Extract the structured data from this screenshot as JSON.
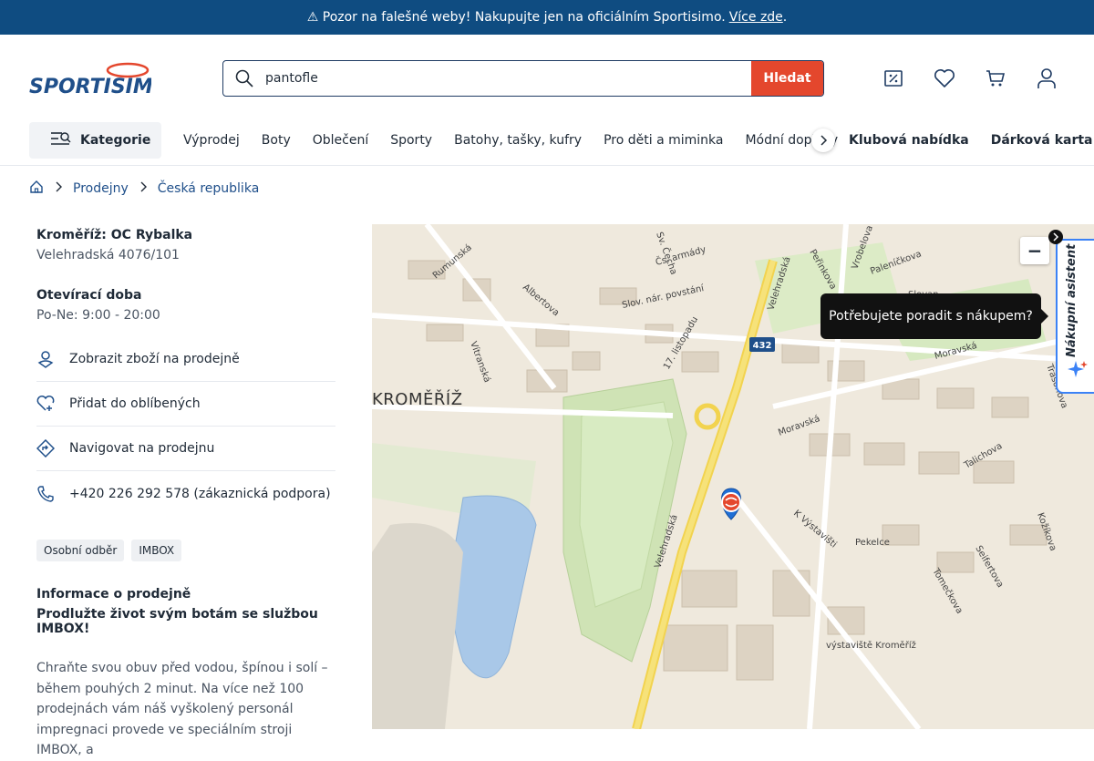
{
  "topbar": {
    "warning": "⚠ Pozor na falešné weby! Nakupujte jen na oficiálním Sportisimo.",
    "link": "Více zde",
    "trailing": "."
  },
  "brand": {
    "logo_text": "SPORTISIMO",
    "logo_color": "#1f4f8a",
    "accent": "#e4472d"
  },
  "search": {
    "value": "pantofle",
    "button": "Hledat"
  },
  "nav": {
    "categories_label": "Kategorie",
    "items": [
      "Výprodej",
      "Boty",
      "Oblečení",
      "Sporty",
      "Batohy, tašky, kufry",
      "Pro děti a miminka",
      "Módní doplňky"
    ],
    "right_items": [
      "Klubová nabídka",
      "Dárková karta"
    ]
  },
  "breadcrumb": {
    "items": [
      "Prodejny",
      "Česká republika"
    ]
  },
  "store": {
    "name": "Kroměříž: OC Rybalka",
    "address": "Velehradská 4076/101",
    "hours_title": "Otevírací doba",
    "hours": "Po-Ne: 9:00 - 20:00"
  },
  "actions": [
    {
      "label": "Zobrazit zboží na prodejně",
      "icon": "store-location-icon"
    },
    {
      "label": "Přidat do oblíbených",
      "icon": "heart-plus-icon"
    },
    {
      "label": "Navigovat na prodejnu",
      "icon": "directions-icon"
    },
    {
      "label": "+420 226 292 578 (zákaznická podpora)",
      "icon": "phone-icon"
    }
  ],
  "tags": [
    "Osobní odběr",
    "IMBOX"
  ],
  "info": {
    "title": "Informace o prodejně",
    "subtitle": "Prodlužte život svým botám se službou IMBOX!",
    "text": "Chraňte svou obuv před vodou, špínou i solí – během pouhých 2 minut. Na více než 100 prodejnách vám náš vyškolený personál impregnaci provede ve speciálním stroji IMBOX, a"
  },
  "map": {
    "city_label": "KROMĚŘÍŽ",
    "streets": [
      "Rumunská",
      "Albertova",
      "Sv. Čecha",
      "Čs. armády",
      "Slov. nár. povstání",
      "Velehradská",
      "Peřinkova",
      "Vrobelova",
      "Paleníčkova",
      "Slovan",
      "Moravská",
      "Trasonova",
      "Vítranská",
      "17. listopadu",
      "Moravská",
      "Talichova",
      "K Výstavišti",
      "Kožíkova",
      "Pekelce",
      "Seifertova",
      "Tomečkova",
      "Velehradská",
      "výstaviště Kroměříž"
    ],
    "road_number": "432",
    "zoom_out": "−"
  },
  "tooltip": {
    "text": "Potřebujete poradit s nákupem?"
  },
  "assistant": {
    "label": "Nákupní asistent"
  }
}
